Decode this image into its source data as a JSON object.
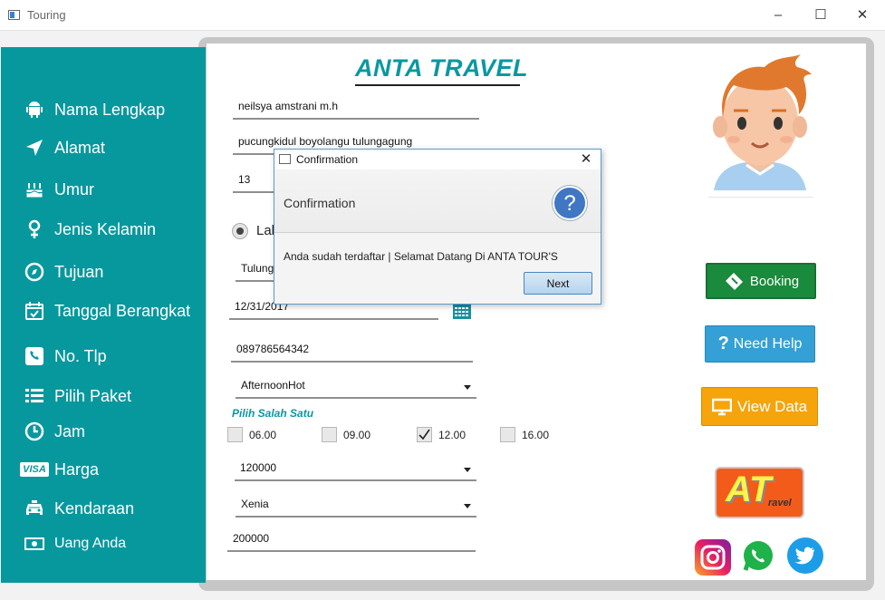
{
  "window": {
    "title": "Touring",
    "minimize": "–",
    "maximize": "☐",
    "close": "✕"
  },
  "sidebar": {
    "items": [
      {
        "label": "Nama Lengkap",
        "icon": "android-icon"
      },
      {
        "label": "Alamat",
        "icon": "navigation-arrow-icon"
      },
      {
        "label": "Umur",
        "icon": "birthday-cake-icon"
      },
      {
        "label": "Jenis Kelamin",
        "icon": "gender-icon"
      },
      {
        "label": "Tujuan",
        "icon": "compass-icon"
      },
      {
        "label": "Tanggal Berangkat",
        "icon": "calendar-check-icon"
      },
      {
        "label": "No. Tlp",
        "icon": "phone-icon"
      },
      {
        "label": "Pilih Paket",
        "icon": "list-icon"
      },
      {
        "label": "Jam",
        "icon": "clock-icon"
      },
      {
        "label": "Harga",
        "icon": "visa-card-icon",
        "badge": "VISA"
      },
      {
        "label": "Kendaraan",
        "icon": "taxi-icon"
      },
      {
        "label": "Uang Anda",
        "icon": "money-icon"
      }
    ]
  },
  "form": {
    "brand_title": "ANTA TRAVEL",
    "nama": "neilsya amstrani m.h",
    "alamat": "pucungkidul boyolangu tulungagung",
    "umur": "13",
    "jenis_kelamin": "Lak",
    "tujuan": "Tulung",
    "tanggal": "12/31/2017",
    "no_tlp": "089786564342",
    "paket": "AfternoonHot",
    "pilih_label": "Pilih Salah Satu",
    "jam_options": [
      {
        "label": "06.00",
        "checked": false
      },
      {
        "label": "09.00",
        "checked": false
      },
      {
        "label": "12.00",
        "checked": true
      },
      {
        "label": "16.00",
        "checked": false
      }
    ],
    "harga": "120000",
    "kendaraan": "Xenia",
    "uang": "200000"
  },
  "buttons": {
    "booking": "Booking",
    "need_help": "Need Help",
    "view_data": "View Data"
  },
  "logo": {
    "text": "AT",
    "sub": "ravel"
  },
  "social": [
    "instagram-icon",
    "whatsapp-icon",
    "twitter-icon"
  ],
  "dialog": {
    "title": "Confirmation",
    "header": "Confirmation",
    "question_mark": "?",
    "message": "Anda sudah terdaftar | Selamat Datang Di ANTA TOUR'S",
    "next_label": "Next",
    "close": "✕"
  },
  "colors": {
    "teal": "#07989e",
    "booking_green": "#1a8a3c",
    "help_blue": "#34a0d5",
    "view_orange": "#f5a40c"
  }
}
